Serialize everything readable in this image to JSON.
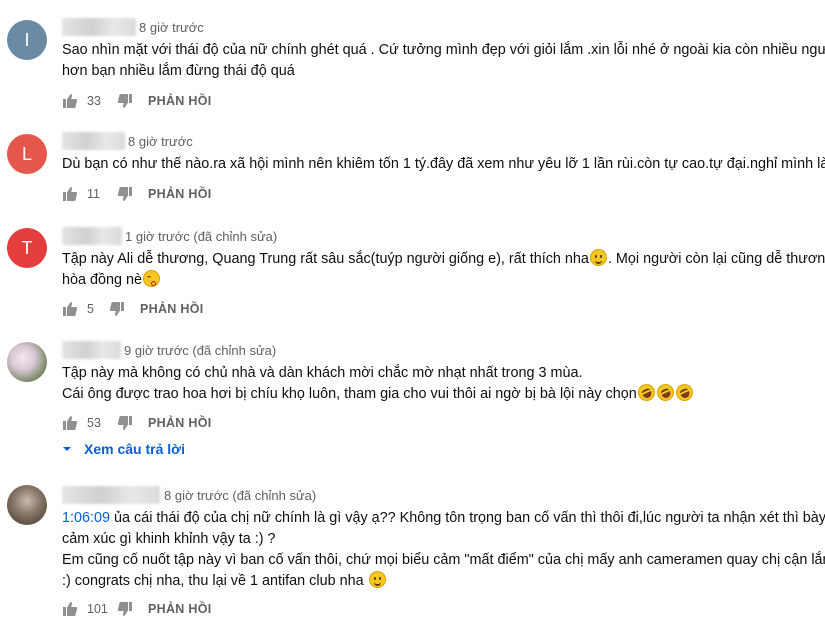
{
  "colors": {
    "link": "#065fd4",
    "meta": "#606060",
    "text": "#0f0f0f"
  },
  "comments": [
    {
      "avatar_initial": "I",
      "avatar_color": "#6b8ba4",
      "time": "8 giờ trước",
      "lines": [
        "Sao nhìn mặt với thái độ của nữ chính ghét quá . Cứ tưởng mình đẹp với giỏi lắm .xin lỗi nhé ở ngoài kia còn nhiều người",
        "hơn bạn nhiều lắm đừng thái độ quá"
      ],
      "likes": "33",
      "reply_label": "PHẢN HỒI"
    },
    {
      "avatar_initial": "L",
      "avatar_color": "#e4574a",
      "time": "8 giờ trước",
      "lines": [
        "Dù bạn có như thế nào.ra xã hội mình nên khiêm tốn 1 tý.đây đã xem như yêu lỡ 1 lần rùi.còn tự cao.tự đại.nghỉ mình là ai"
      ],
      "likes": "11",
      "reply_label": "PHẢN HỒI"
    },
    {
      "avatar_initial": "T",
      "avatar_color": "#e53c3c",
      "time": "1 giờ trước (đã chỉnh sửa)",
      "lines": [
        "Tập này Ali dễ thương, Quang Trung rất sâu sắc(tuýp người giống e), rất thích nha",
        ". Mọi người còn lại cũng dễ thương,",
        "hòa đồng nè"
      ],
      "likes": "5",
      "reply_label": "PHẢN HỒI"
    },
    {
      "time": "9 giờ trước (đã chỉnh sửa)",
      "lines": [
        "Tập này mà không có chủ nhà và dàn khách mời chắc mờ nhạt nhất trong 3 mùa.",
        "Cái ông được trao hoa hơi bị chíu khọ luôn, tham gia cho vui thôi ai ngờ bị bà lội này chọn"
      ],
      "likes": "53",
      "reply_label": "PHẢN HỒI",
      "show_replies": "Xem câu trả lời"
    },
    {
      "time": "8 giờ trước (đã chỉnh sửa)",
      "timestamp_link": "1:06:09",
      "lines": [
        " ủa cái thái độ của chị nữ chính là gì vậy ạ?? Không tôn trọng ban cố vấn thì thôi đi,lúc người ta nhận xét thì bày",
        "cảm xúc gì khinh khỉnh vậy ta :) ?",
        "Em cũng cố nuốt tập này vì ban cố vấn thôi, chứ mọi biểu cảm \"mất điểm\" của chị mấy anh cameramen quay chị cận lắm",
        ":) congrats chị nha, thu lại về 1 antifan club nha "
      ],
      "likes": "101",
      "reply_label": "PHẢN HỒI"
    }
  ]
}
